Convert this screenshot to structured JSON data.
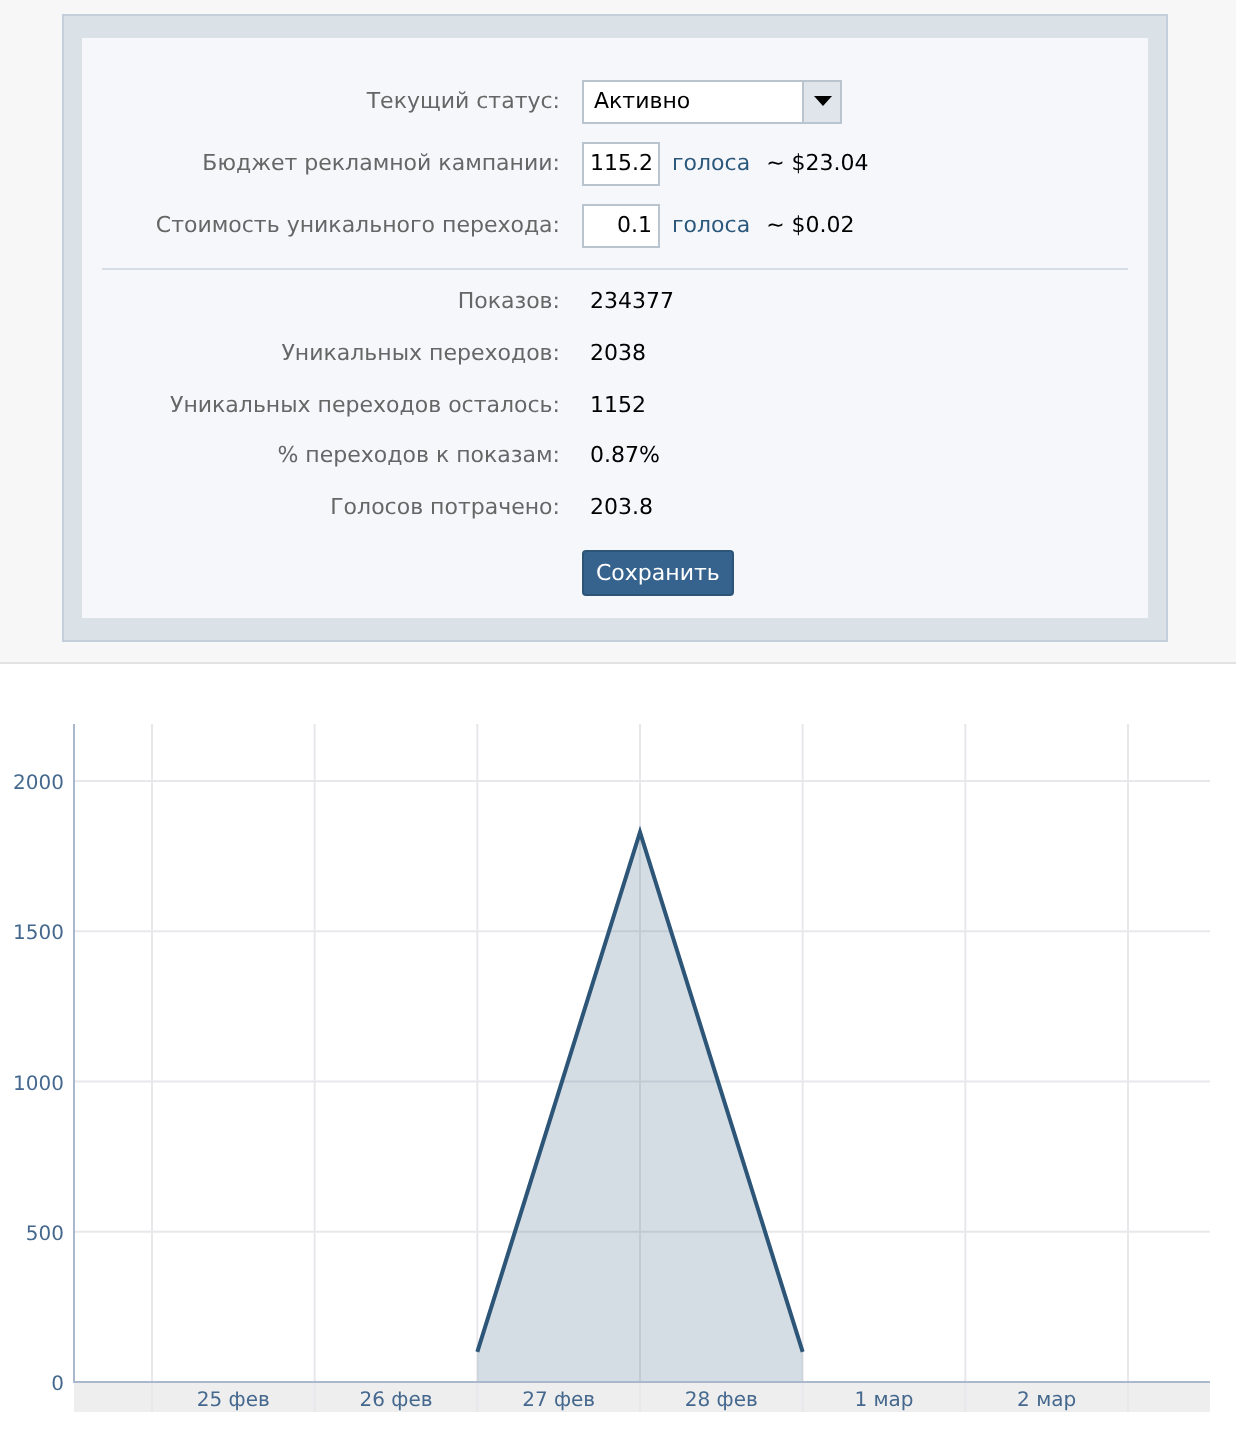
{
  "form": {
    "fields": [
      {
        "kind": "select",
        "label": "Текущий статус:",
        "value": "Активно"
      },
      {
        "kind": "amount",
        "label": "Бюджет рекламной кампании:",
        "value": "115.2",
        "unit": "голоса",
        "approx": "~ $23.04"
      },
      {
        "kind": "amount",
        "label": "Стоимость уникального перехода:",
        "value": "0.1",
        "unit": "голоса",
        "approx": "~ $0.02"
      }
    ],
    "stats": [
      {
        "label": "Показов:",
        "value": "234377"
      },
      {
        "label": "Уникальных переходов:",
        "value": "2038"
      },
      {
        "label": "Уникальных переходов осталось:",
        "value": "1152"
      },
      {
        "label": "% переходов к показам:",
        "value": "0.87%"
      },
      {
        "label": "Голосов потрачено:",
        "value": "203.8"
      }
    ],
    "save_button": "Сохранить"
  },
  "chart": {
    "chart_data": {
      "type": "area",
      "categories": [
        null,
        "25 фев",
        null,
        "26 фев",
        null,
        "27 фев",
        null,
        "28 фев",
        null,
        "1 мар",
        null,
        "2 мар",
        null
      ],
      "series": [
        {
          "color": "#2d5577",
          "values": [
            null,
            null,
            null,
            null,
            100,
            965,
            1830,
            965,
            100,
            null,
            null,
            null,
            null
          ]
        }
      ],
      "ylim": [
        0,
        2190
      ],
      "grid": true,
      "yticks": [
        0,
        500,
        1000,
        1500,
        2000
      ]
    }
  }
}
